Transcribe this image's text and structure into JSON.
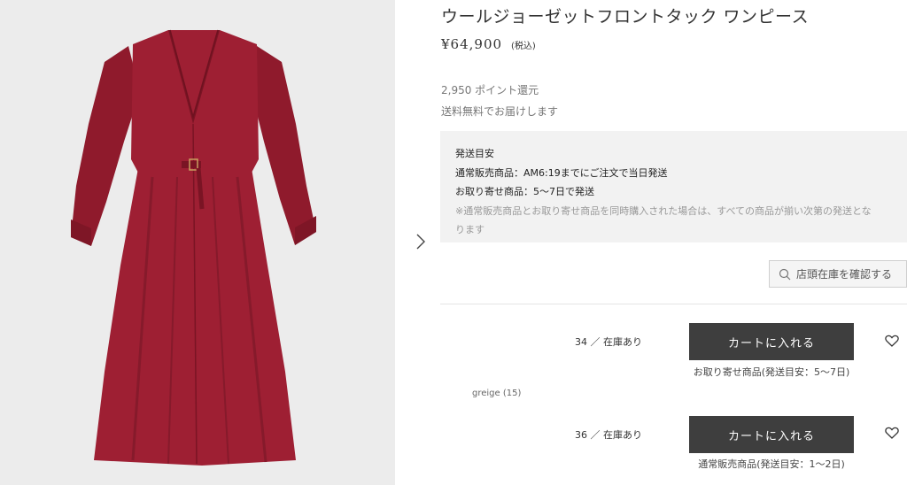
{
  "product": {
    "title": "ウールジョーゼットフロントタック ワンピース",
    "price": "¥64,900",
    "tax_label": "(税込)",
    "points": "2,950 ポイント還元",
    "shipping_free": "送料無料でお届けします",
    "image_subject": "red wine-colored long dress"
  },
  "shipping_info": {
    "heading": "発送目安",
    "line1": "通常販売商品：AM6:19までにご注文で当日発送",
    "line2": "お取り寄せ商品：5～7日で発送",
    "note_line1": "※通常販売商品とお取り寄せ商品を同時購入された場合は、すべての商品が揃い次第の発送とな",
    "note_line2": "ります"
  },
  "store_check": {
    "label": "店頭在庫を確認する",
    "icon": "search-icon"
  },
  "color_group": {
    "label": "greige (15)"
  },
  "variants": [
    {
      "size_stock": "34 ／ 在庫あり",
      "cart_label": "カートに入れる",
      "delivery_note": "お取り寄せ商品(発送目安：5～7日)"
    },
    {
      "size_stock": "36 ／ 在庫あり",
      "cart_label": "カートに入れる",
      "delivery_note": "通常販売商品(発送目安：1～2日)"
    }
  ],
  "colors": {
    "dress": "#9e1f33",
    "photo_bg": "#ececec",
    "cart_button": "#3e3e3e",
    "info_box": "#f2f2f2"
  }
}
